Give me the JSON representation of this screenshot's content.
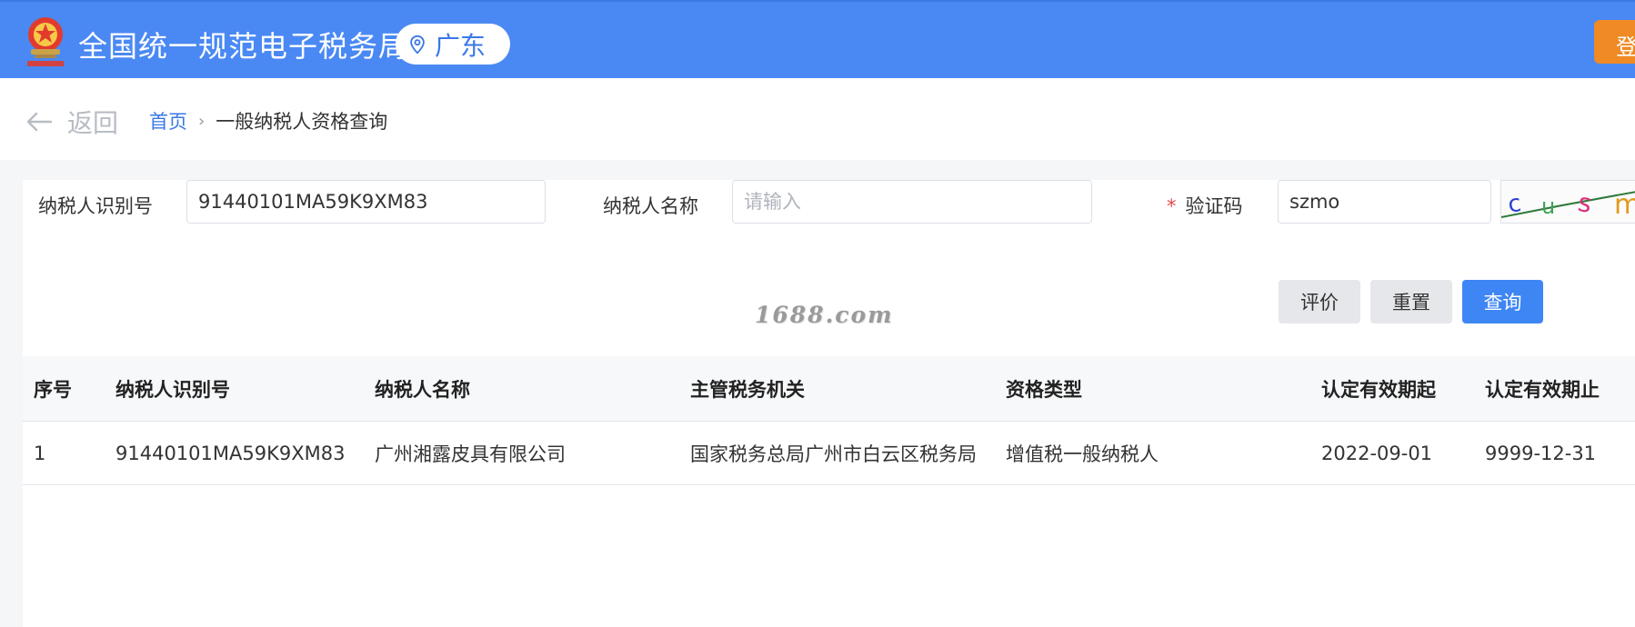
{
  "header": {
    "title": "全国统一规范电子税务局",
    "region": "广东",
    "login_label": "登录",
    "colors": {
      "bar": "#4a89f3",
      "login": "#f08a24"
    }
  },
  "breadcrumb": {
    "back_label": "返回",
    "home": "首页",
    "separator": "›",
    "current": "一般纳税人资格查询"
  },
  "form": {
    "taxpayer_id_label": "纳税人识别号",
    "taxpayer_id_value": "91440101MA59K9XM83",
    "taxpayer_name_label": "纳税人名称",
    "taxpayer_name_placeholder": "请输入",
    "captcha_label": "验证码",
    "captcha_required_mark": "*",
    "captcha_value": "szmo",
    "captcha_image_text": "cusm"
  },
  "buttons": {
    "evaluate": "评价",
    "reset": "重置",
    "query": "查询"
  },
  "watermark": "1688.com",
  "table": {
    "columns": [
      "序号",
      "纳税人识别号",
      "纳税人名称",
      "主管税务机关",
      "资格类型",
      "认定有效期起",
      "认定有效期止"
    ],
    "rows": [
      [
        "1",
        "91440101MA59K9XM83",
        "广州湘露皮具有限公司",
        "国家税务总局广州市白云区税务局",
        "增值税一般纳税人",
        "2022-09-01",
        "9999-12-31"
      ]
    ]
  }
}
